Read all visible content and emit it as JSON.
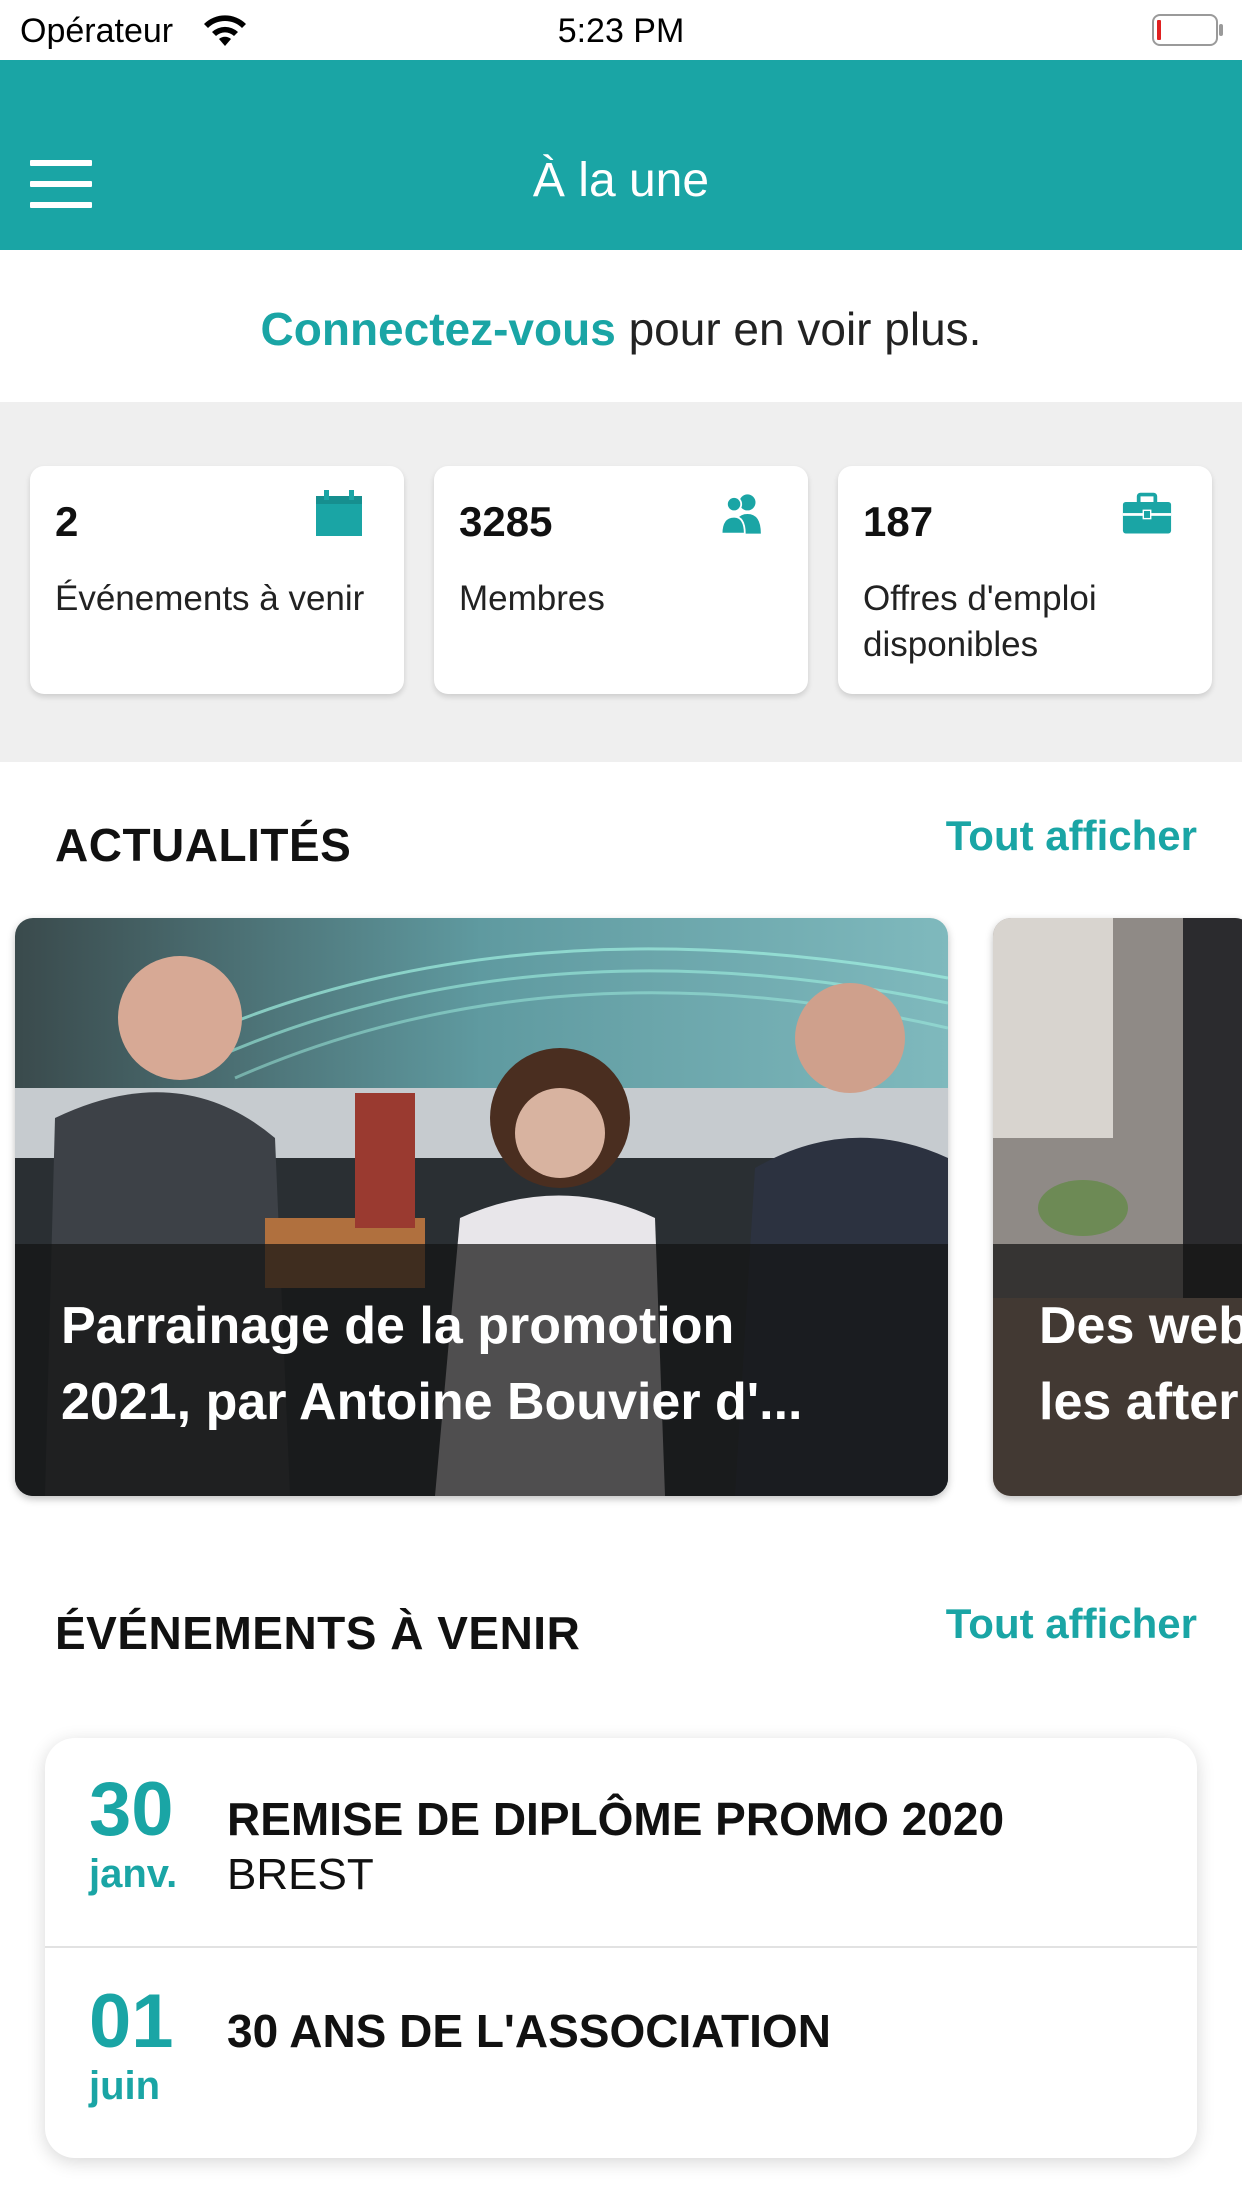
{
  "status_bar": {
    "carrier": "Opérateur",
    "time": "5:23 PM"
  },
  "nav": {
    "title": "À la une"
  },
  "login_banner": {
    "link": "Connectez-vous",
    "text": " pour en voir plus."
  },
  "stats": [
    {
      "value": "2",
      "label": "Événements à venir",
      "icon": "calendar-icon"
    },
    {
      "value": "3285",
      "label": "Membres",
      "icon": "members-icon"
    },
    {
      "value": "187",
      "label": "Offres d'emploi disponibles",
      "icon": "briefcase-icon"
    }
  ],
  "news": {
    "title": "ACTUALITÉS",
    "see_all": "Tout afficher",
    "items": [
      {
        "title": "Parrainage de la promotion\n2021, par Antoine Bouvier d'..."
      },
      {
        "title": "Des web\nles after"
      }
    ]
  },
  "events": {
    "title": "ÉVÉNEMENTS À VENIR",
    "see_all": "Tout afficher",
    "items": [
      {
        "day": "30",
        "month": "janv.",
        "title": "REMISE DE DIPLÔME PROMO 2020",
        "place": "BREST"
      },
      {
        "day": "01",
        "month": "juin",
        "title": "30 ANS DE L'ASSOCIATION",
        "place": ""
      }
    ]
  },
  "colors": {
    "accent": "#1aa5a5",
    "background": "#efefef"
  }
}
